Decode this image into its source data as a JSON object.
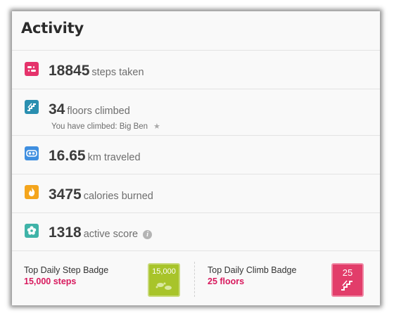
{
  "title": "Activity",
  "stats": [
    {
      "value": "18845",
      "unit": "steps taken",
      "icon": "steps-icon",
      "color": "#e5336b"
    },
    {
      "value": "34",
      "unit": "floors climbed",
      "icon": "stairs-icon",
      "color": "#2a8fb0",
      "note": "You have climbed: Big Ben"
    },
    {
      "value": "16.65",
      "unit": "km traveled",
      "icon": "distance-icon",
      "color": "#3f8fe0"
    },
    {
      "value": "3475",
      "unit": "calories burned",
      "icon": "flame-icon",
      "color": "#f4a51c"
    },
    {
      "value": "1318",
      "unit": "active score",
      "icon": "flower-icon",
      "color": "#3fb3a8"
    }
  ],
  "badges": [
    {
      "label": "Top Daily Step Badge",
      "value": "15,000 steps",
      "badge_text": "15,000",
      "color": "#a8c42a",
      "icon": "step-badge-icon"
    },
    {
      "label": "Top Daily Climb Badge",
      "value": "25 floors",
      "badge_text": "25",
      "color": "#e23d6a",
      "icon": "climb-badge-icon"
    }
  ]
}
